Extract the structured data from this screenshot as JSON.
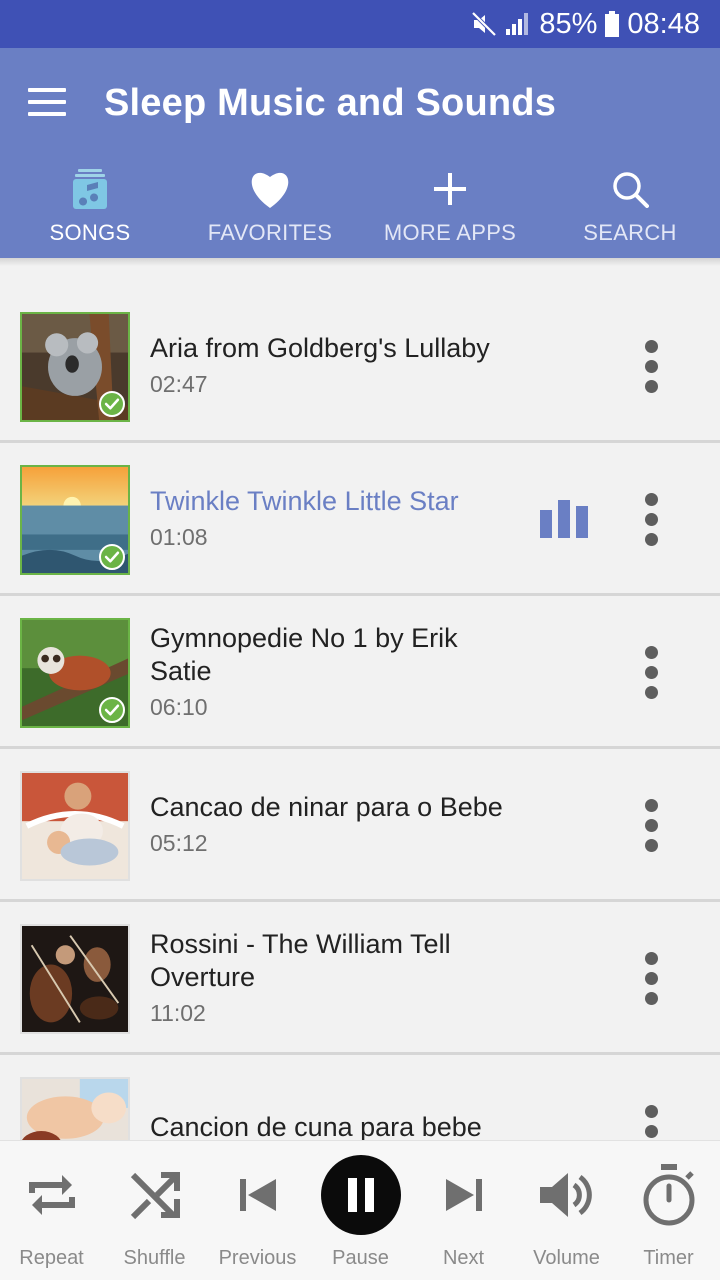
{
  "status_bar": {
    "battery": "85%",
    "time": "08:48"
  },
  "app": {
    "title": "Sleep Music and Sounds"
  },
  "tabs": [
    {
      "label": "SONGS",
      "icon": "music-library-icon",
      "active": true
    },
    {
      "label": "FAVORITES",
      "icon": "heart-icon",
      "active": false
    },
    {
      "label": "MORE APPS",
      "icon": "plus-icon",
      "active": false
    },
    {
      "label": "SEARCH",
      "icon": "search-icon",
      "active": false
    }
  ],
  "songs": [
    {
      "title": "Aria from Goldberg's Lullaby",
      "duration": "02:47",
      "thumb": "koala",
      "downloaded": true,
      "playing": false
    },
    {
      "title": "Twinkle Twinkle Little Star",
      "duration": "01:08",
      "thumb": "ocean-sunset",
      "downloaded": true,
      "playing": true
    },
    {
      "title": "Gymnopedie No 1 by Erik Satie",
      "duration": "06:10",
      "thumb": "red-panda",
      "downloaded": true,
      "playing": false
    },
    {
      "title": "Cancao de ninar para o Bebe",
      "duration": "05:12",
      "thumb": "baby",
      "downloaded": false,
      "playing": false
    },
    {
      "title": "Rossini - The William Tell Overture",
      "duration": "11:02",
      "thumb": "violins",
      "downloaded": false,
      "playing": false
    },
    {
      "title": "Cancion de cuna para bebe",
      "duration": "",
      "thumb": "sleeping-baby",
      "downloaded": false,
      "playing": false
    }
  ],
  "player": {
    "repeat": "Repeat",
    "shuffle": "Shuffle",
    "previous": "Previous",
    "pause": "Pause",
    "next": "Next",
    "volume": "Volume",
    "timer": "Timer"
  },
  "colors": {
    "status_bar": "#3f51b5",
    "app_bar": "#6a7fc4",
    "accent": "#6a7fc4",
    "downloaded_check": "#6bb446"
  }
}
